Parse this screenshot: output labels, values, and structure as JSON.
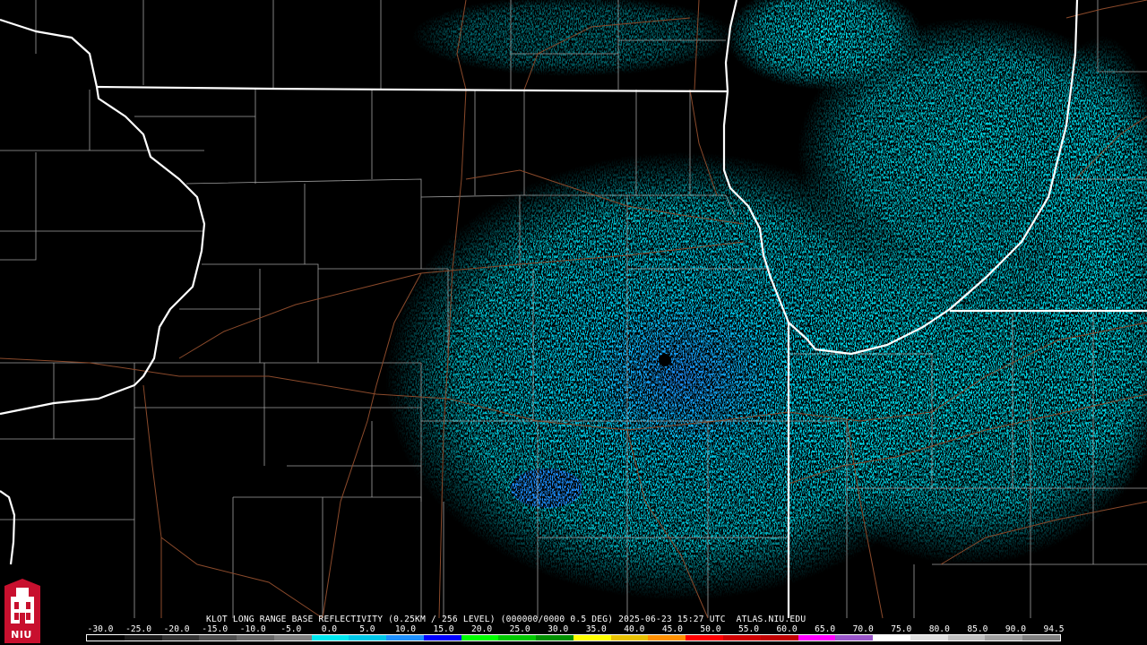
{
  "caption": "KLOT LONG RANGE BASE REFLECTIVITY (0.25KM / 256 LEVEL) (000000/0000 0.5 DEG) 2025-06-23 15:27 UTC  ATLAS.NIU.EDU",
  "logo": {
    "text": "NIU",
    "icon": "niu-tower-logo-icon",
    "color": "#c8102e"
  },
  "colors": {
    "background": "#000000",
    "state_border": "#ffffff",
    "county_border": "#a0a0a0",
    "road": "#8b4a2b",
    "echo_light": "#00d8e8",
    "echo_mid": "#1e90ff"
  },
  "scale": {
    "labels": [
      "-30.0",
      "-25.0",
      "-20.0",
      "-15.0",
      "-10.0",
      "-5.0",
      "0.0",
      "5.0",
      "10.0",
      "15.0",
      "20.0",
      "25.0",
      "30.0",
      "35.0",
      "40.0",
      "45.0",
      "50.0",
      "55.0",
      "60.0",
      "65.0",
      "70.0",
      "75.0",
      "80.0",
      "85.0",
      "90.0",
      "94.5"
    ],
    "colors": [
      "#000000",
      "#1a1a1a",
      "#333333",
      "#4d4d4d",
      "#666666",
      "#808080",
      "#00e8f0",
      "#00c8e8",
      "#1e90ff",
      "#0000ff",
      "#00ff00",
      "#00c800",
      "#009000",
      "#ffff00",
      "#e7c000",
      "#ff9000",
      "#ff0000",
      "#d00000",
      "#c00000",
      "#ff00ff",
      "#9955c9",
      "#ffffff",
      "#e0e0e0",
      "#c0c0c0",
      "#a0a0a0",
      "#808080"
    ]
  }
}
